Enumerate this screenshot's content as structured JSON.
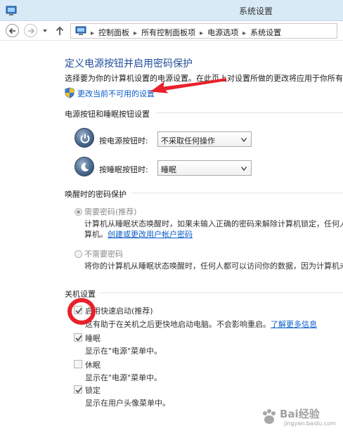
{
  "window": {
    "title": "系统设置"
  },
  "address": {
    "crumbs": [
      "控制面板",
      "所有控制面板项",
      "电源选项",
      "系统设置"
    ]
  },
  "main": {
    "title": "定义电源按钮并启用密码保护",
    "description": "选择要为你的计算机设置的电源设置。在此页上对设置所做的更改将应用于你所有的",
    "change_link": "更改当前不可用的设置"
  },
  "power_section": {
    "heading": "电源按钮和睡眠按钮设置",
    "power_button_label": "按电源按钮时:",
    "power_button_value": "不采取任何操作",
    "sleep_button_label": "按睡眠按钮时:",
    "sleep_button_value": "睡眠"
  },
  "password_section": {
    "heading": "唤醒时的密码保护",
    "require_label": "需要密码(推荐)",
    "require_desc_1": "计算机从睡眠状态唤醒时，如果未输入正确的密码来解除计算机锁定，任何人",
    "require_desc_2_prefix": "算机。",
    "require_link": "创建或更改用户帐户密码",
    "no_require_label": "不需要密码",
    "no_require_desc": "将你的计算机从睡眠状态唤醒时，任何人都可以访问你的数据，因为计算机未"
  },
  "shutdown_section": {
    "heading": "关机设置",
    "items": [
      {
        "label": "启用快速启动(推荐)",
        "desc": "这有助于在关机之后更快地启动电脑。不会影响重启。",
        "link": "了解更多信息",
        "checked": true
      },
      {
        "label": "睡眠",
        "desc": "显示在\"电源\"菜单中。",
        "checked": true
      },
      {
        "label": "休眠",
        "desc": "显示在\"电源\"菜单中。",
        "checked": false
      },
      {
        "label": "锁定",
        "desc": "显示在用户头像菜单中。",
        "checked": true
      }
    ]
  },
  "colors": {
    "title_blue": "#1f4e9a",
    "link_blue": "#0b5dc8",
    "annotation_red": "#e8212b"
  },
  "watermark": {
    "text": "Bai经验",
    "sub": "jingyan.baidu.com"
  }
}
